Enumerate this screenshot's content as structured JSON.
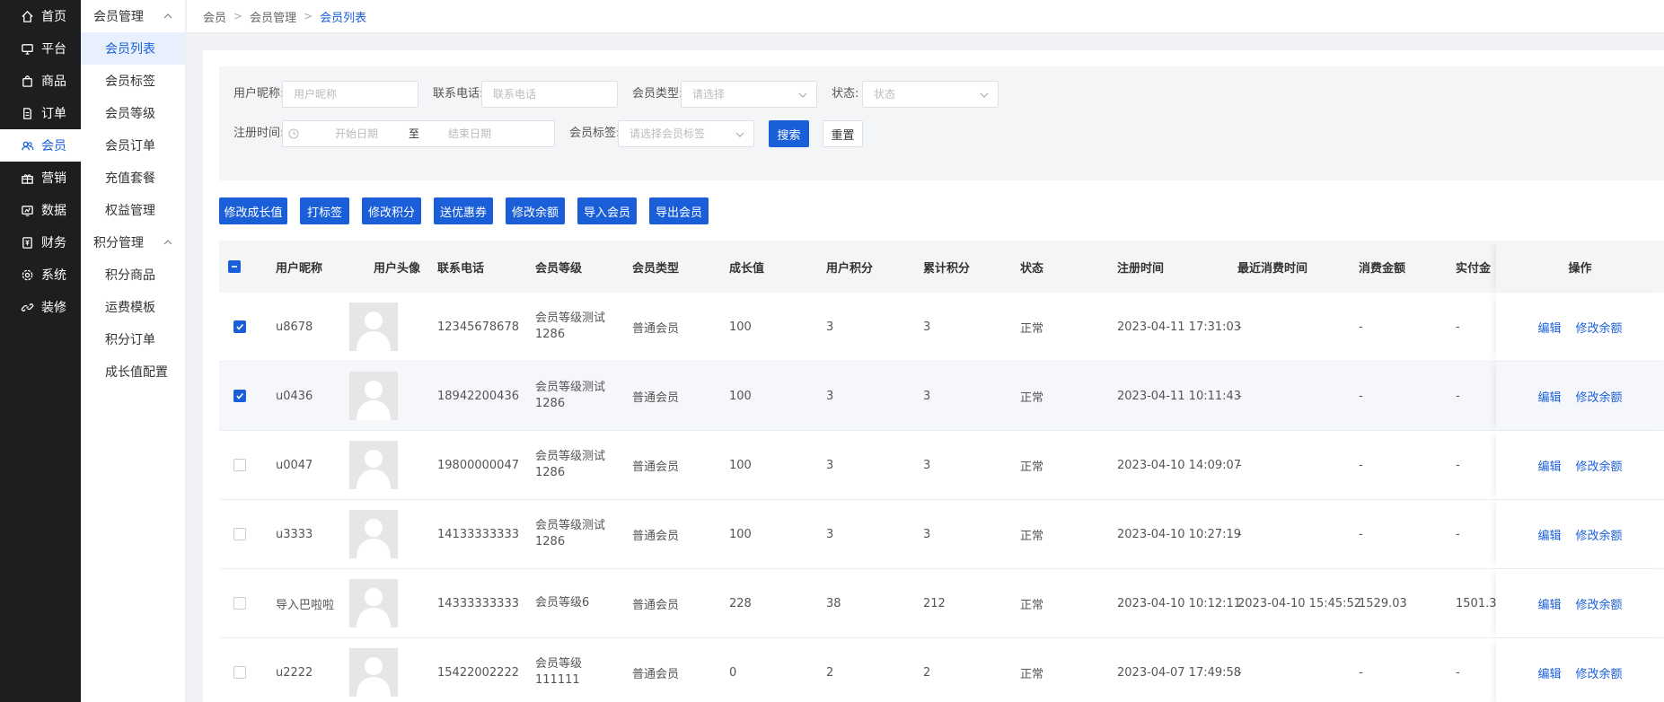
{
  "nav": [
    {
      "label": "首页",
      "icon": "home-icon"
    },
    {
      "label": "平台",
      "icon": "monitor-icon"
    },
    {
      "label": "商品",
      "icon": "bag-icon"
    },
    {
      "label": "订单",
      "icon": "document-icon"
    },
    {
      "label": "会员",
      "icon": "users-icon",
      "active": true
    },
    {
      "label": "营销",
      "icon": "gift-icon"
    },
    {
      "label": "数据",
      "icon": "chart-icon"
    },
    {
      "label": "财务",
      "icon": "finance-icon"
    },
    {
      "label": "系统",
      "icon": "gear-icon"
    },
    {
      "label": "装修",
      "icon": "link-icon"
    }
  ],
  "subnav": {
    "group1": {
      "title": "会员管理",
      "items": [
        "会员列表",
        "会员标签",
        "会员等级",
        "会员订单",
        "充值套餐",
        "权益管理"
      ]
    },
    "group2": {
      "title": "积分管理",
      "items": [
        "积分商品",
        "运费模板",
        "积分订单",
        "成长值配置"
      ]
    }
  },
  "breadcrumb": [
    "会员",
    "会员管理",
    "会员列表"
  ],
  "filters": {
    "nickname_label": "用户昵称:",
    "nickname_placeholder": "用户昵称",
    "phone_label": "联系电话:",
    "phone_placeholder": "联系电话",
    "type_label": "会员类型:",
    "type_placeholder": "请选择",
    "status_label": "状态:",
    "status_placeholder": "状态",
    "regtime_label": "注册时间:",
    "start_placeholder": "开始日期",
    "range_sep": "至",
    "end_placeholder": "结束日期",
    "tag_label": "会员标签:",
    "tag_placeholder": "请选择会员标签",
    "search": "搜索",
    "reset": "重置"
  },
  "actions": [
    "修改成长值",
    "打标签",
    "修改积分",
    "送优惠券",
    "修改余额",
    "导入会员",
    "导出会员"
  ],
  "table": {
    "headers": [
      "用户昵称",
      "用户头像",
      "联系电话",
      "会员等级",
      "会员类型",
      "成长值",
      "用户积分",
      "累计积分",
      "状态",
      "注册时间",
      "最近消费时间",
      "消费金额",
      "实付金",
      "操作"
    ],
    "rows": [
      {
        "checked": true,
        "nickname": "u8678",
        "phone": "12345678678",
        "level": "会员等级测试1286",
        "type": "普通会员",
        "growth": "100",
        "points": "3",
        "total_points": "3",
        "status": "正常",
        "reg_time": "2023-04-11 17:31:03",
        "last_time": "-",
        "spend": "-",
        "paid": "-"
      },
      {
        "checked": true,
        "nickname": "u0436",
        "phone": "18942200436",
        "level": "会员等级测试1286",
        "type": "普通会员",
        "growth": "100",
        "points": "3",
        "total_points": "3",
        "status": "正常",
        "reg_time": "2023-04-11 10:11:43",
        "last_time": "-",
        "spend": "-",
        "paid": "-"
      },
      {
        "checked": false,
        "nickname": "u0047",
        "phone": "19800000047",
        "level": "会员等级测试1286",
        "type": "普通会员",
        "growth": "100",
        "points": "3",
        "total_points": "3",
        "status": "正常",
        "reg_time": "2023-04-10 14:09:07",
        "last_time": "-",
        "spend": "-",
        "paid": "-"
      },
      {
        "checked": false,
        "nickname": "u3333",
        "phone": "14133333333",
        "level": "会员等级测试1286",
        "type": "普通会员",
        "growth": "100",
        "points": "3",
        "total_points": "3",
        "status": "正常",
        "reg_time": "2023-04-10 10:27:19",
        "last_time": "-",
        "spend": "-",
        "paid": "-"
      },
      {
        "checked": false,
        "nickname": "导入巴啦啦",
        "phone": "14333333333",
        "level": "会员等级6",
        "type": "普通会员",
        "growth": "228",
        "points": "38",
        "total_points": "212",
        "status": "正常",
        "reg_time": "2023-04-10 10:12:11",
        "last_time": "2023-04-10 15:45:52",
        "spend": "1529.03",
        "paid": "1501.3"
      },
      {
        "checked": false,
        "nickname": "u2222",
        "phone": "15422002222",
        "level": "会员等级111111",
        "type": "普通会员",
        "growth": "0",
        "points": "2",
        "total_points": "2",
        "status": "正常",
        "reg_time": "2023-04-07 17:49:58",
        "last_time": "-",
        "spend": "-",
        "paid": "-"
      }
    ],
    "op_edit": "编辑",
    "op_balance": "修改余额"
  }
}
